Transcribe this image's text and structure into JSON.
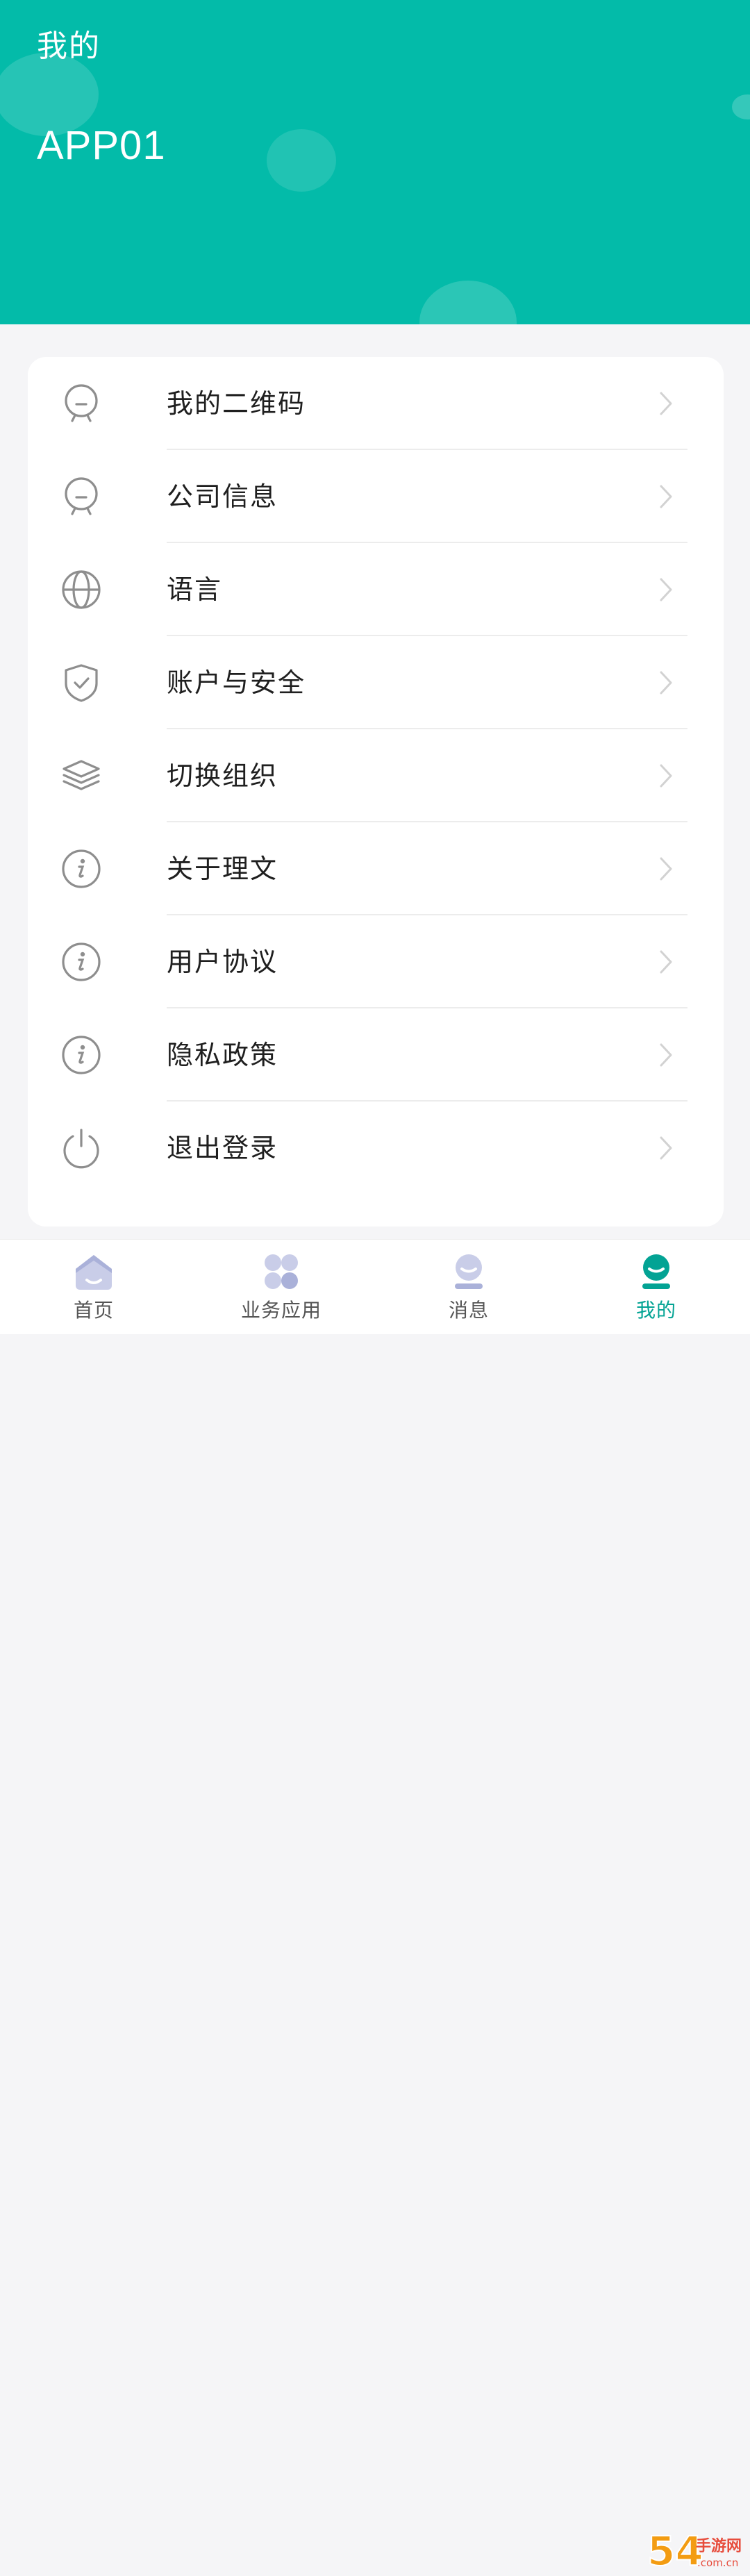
{
  "header": {
    "title": "我的",
    "user_name": "APP01",
    "background_color": "#03bba9"
  },
  "menu": {
    "items": [
      {
        "label": "我的二维码",
        "icon": "robot-face-icon"
      },
      {
        "label": "公司信息",
        "icon": "robot-face-icon"
      },
      {
        "label": "语言",
        "icon": "globe-icon"
      },
      {
        "label": "账户与安全",
        "icon": "shield-check-icon"
      },
      {
        "label": "切换组织",
        "icon": "layers-icon"
      },
      {
        "label": "关于理文",
        "icon": "info-icon"
      },
      {
        "label": "用户协议",
        "icon": "info-icon"
      },
      {
        "label": "隐私政策",
        "icon": "info-icon"
      },
      {
        "label": "退出登录",
        "icon": "power-icon"
      }
    ]
  },
  "tabbar": {
    "active_tab": "我的",
    "active_color": "#03a394",
    "tabs": [
      {
        "label": "首页",
        "icon": "home-icon"
      },
      {
        "label": "业务应用",
        "icon": "apps-grid-icon"
      },
      {
        "label": "消息",
        "icon": "message-icon"
      },
      {
        "label": "我的",
        "icon": "profile-icon"
      }
    ]
  },
  "watermark": {
    "text": "54手游网",
    "subtext": ".com.cn"
  }
}
